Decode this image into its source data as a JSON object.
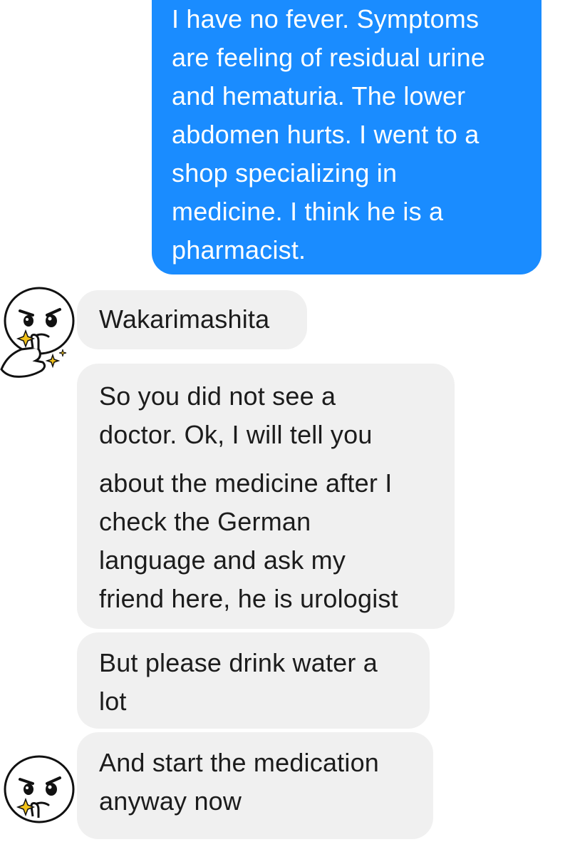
{
  "conversation": {
    "outgoing": [
      {
        "lines": [
          "I have no fever. Symptoms",
          "are feeling of residual urine",
          "and hematuria. The lower",
          "abdomen hurts. I went to a",
          "shop specializing in",
          "medicine. I think he is a",
          "pharmacist."
        ]
      }
    ],
    "incoming": [
      {
        "lines": [
          "Wakarimashita"
        ]
      },
      {
        "lines": [
          "So you did not see a",
          "doctor. Ok, I will tell you"
        ]
      },
      {
        "lines": [
          "about the medicine after I",
          "check the German",
          "language and ask my",
          "friend here, he is urologist"
        ]
      },
      {
        "lines": [
          "But please drink water a",
          "lot"
        ]
      },
      {
        "lines": [
          "And start the medication",
          "anyway now"
        ]
      }
    ],
    "avatar": {
      "icon": "thinking-thumb-sticker-avatar",
      "colors": {
        "face": "#ffffff",
        "outline": "#111111",
        "sparkle": "#f2c21a"
      }
    },
    "colors": {
      "outgoing_bubble": "#1a8cff",
      "outgoing_text": "#ffffff",
      "incoming_bubble": "#f0f0f0",
      "incoming_text": "#1c1c1c"
    }
  }
}
